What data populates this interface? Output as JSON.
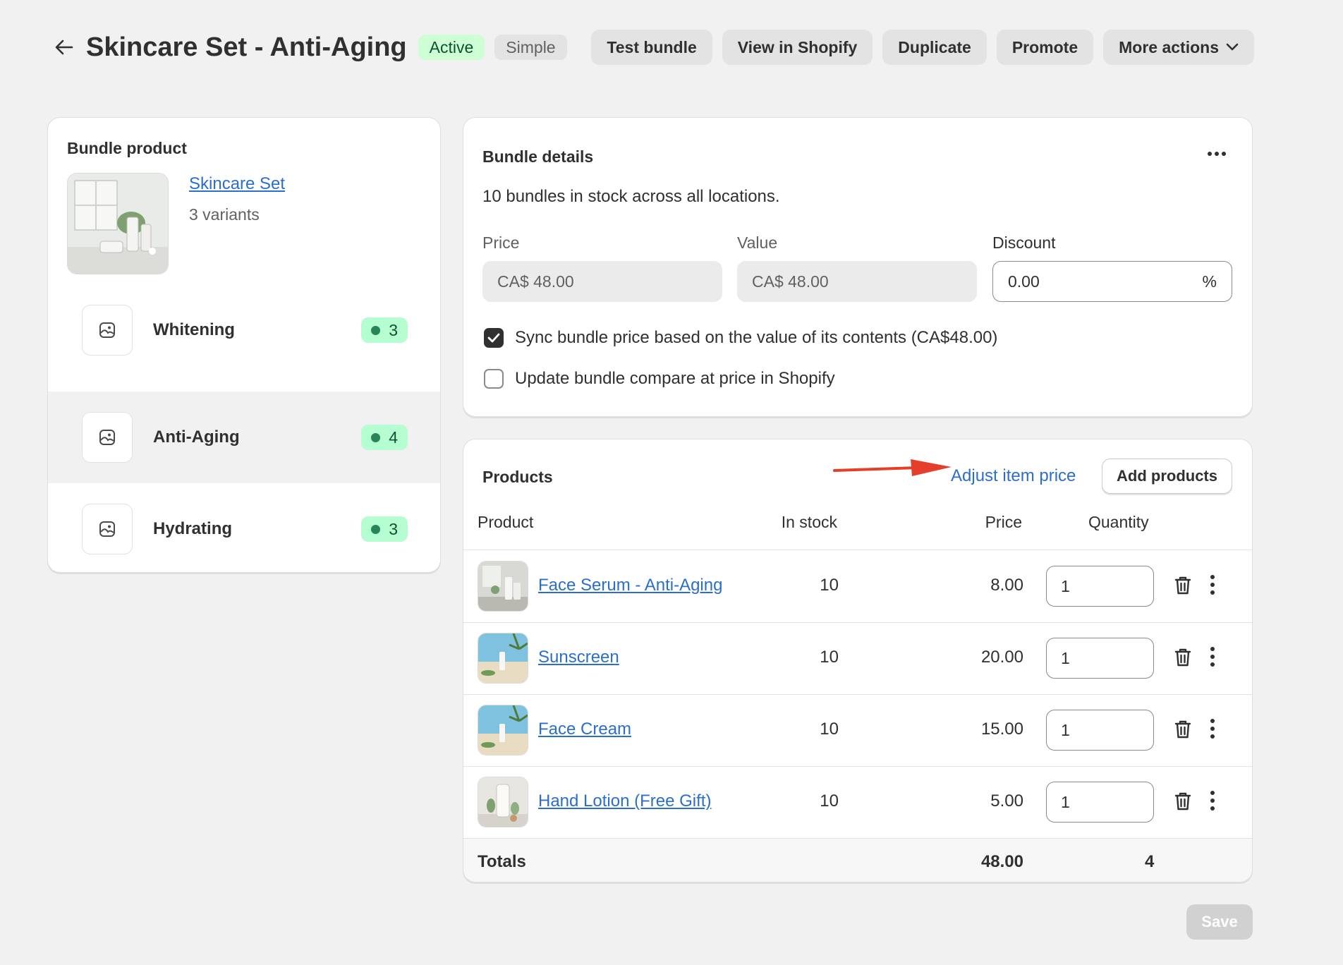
{
  "header": {
    "title": "Skincare Set - Anti-Aging",
    "status_badge": "Active",
    "type_badge": "Simple",
    "actions": {
      "test_bundle": "Test bundle",
      "view_in_shopify": "View in Shopify",
      "duplicate": "Duplicate",
      "promote": "Promote",
      "more_actions": "More actions"
    }
  },
  "bundle_product": {
    "title": "Bundle product",
    "name": "Skincare Set",
    "variants_text": "3 variants",
    "variants": [
      {
        "label": "Whitening",
        "count": "3",
        "selected": false
      },
      {
        "label": "Anti-Aging",
        "count": "4",
        "selected": true
      },
      {
        "label": "Hydrating",
        "count": "3",
        "selected": false
      }
    ]
  },
  "bundle_details": {
    "title": "Bundle details",
    "stock_text": "10 bundles in stock across all locations.",
    "price_label": "Price",
    "price_value": "CA$  48.00",
    "value_label": "Value",
    "value_value": "CA$  48.00",
    "discount_label": "Discount",
    "discount_value": "0.00",
    "discount_suffix": "%",
    "sync_label": "Sync bundle price based on the value of its contents (CA$48.00)",
    "sync_checked": true,
    "compare_label": "Update bundle compare at price in Shopify",
    "compare_checked": false
  },
  "products": {
    "title": "Products",
    "adjust_link": "Adjust item price",
    "add_button": "Add products",
    "columns": {
      "product": "Product",
      "in_stock": "In stock",
      "price": "Price",
      "quantity": "Quantity"
    },
    "rows": [
      {
        "name": "Face Serum - Anti-Aging",
        "in_stock": "10",
        "price": "8.00",
        "quantity": "1"
      },
      {
        "name": "Sunscreen",
        "in_stock": "10",
        "price": "20.00",
        "quantity": "1"
      },
      {
        "name": "Face Cream",
        "in_stock": "10",
        "price": "15.00",
        "quantity": "1"
      },
      {
        "name": "Hand Lotion (Free Gift)",
        "in_stock": "10",
        "price": "5.00",
        "quantity": "1"
      }
    ],
    "totals": {
      "label": "Totals",
      "price": "48.00",
      "quantity": "4"
    }
  },
  "save_button": "Save",
  "colors": {
    "accent_link": "#2c6ecb",
    "annotation_arrow": "#e53e2b",
    "active_badge": "#cdfed4",
    "count_badge": "#b4fed2"
  }
}
